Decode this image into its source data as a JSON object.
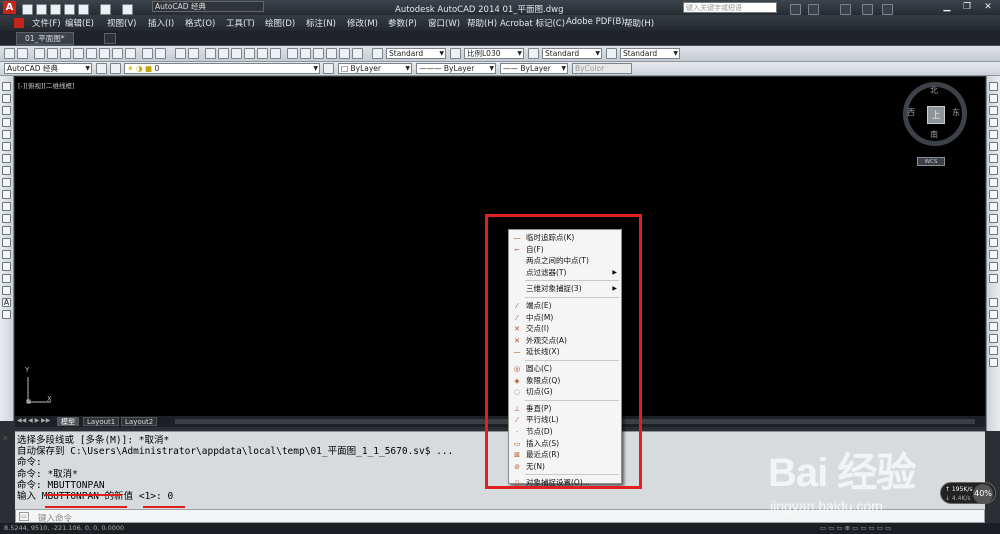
{
  "title_bar": {
    "workspace": "AutoCAD 经典",
    "title": "Autodesk AutoCAD 2014    01_平面图.dwg",
    "search_placeholder": "键入关键字或短语",
    "app_letter": "A"
  },
  "menu": [
    "文件(F)",
    "编辑(E)",
    "视图(V)",
    "插入(I)",
    "格式(O)",
    "工具(T)",
    "绘图(D)",
    "标注(N)",
    "修改(M)",
    "参数(P)",
    "窗口(W)",
    "帮助(H)",
    "Acrobat 标记(C)",
    "Adobe PDF(B)",
    "帮助(H)"
  ],
  "doc_tabs": [
    "01_平面图*"
  ],
  "toolbar": {
    "text_style": "Standard",
    "dim_style": "比例L030",
    "table_style": "Standard",
    "mleader_style": "Standard"
  },
  "toolbar2": {
    "workspace": "AutoCAD 经典",
    "layer": "0",
    "color": "ByLayer",
    "linetype": "ByLayer",
    "lineweight": "ByLayer",
    "plotstyle": "ByColor"
  },
  "viewport_label": "[-][俯视][二维线框]",
  "navcube": {
    "top": "上",
    "north": "北",
    "south": "南",
    "east": "东",
    "west": "西",
    "wcs": "WCS"
  },
  "ucs": {
    "y": "Y",
    "x": "X"
  },
  "layout_tabs": [
    "模型",
    "Layout1",
    "Layout2"
  ],
  "context_menu": {
    "items": [
      {
        "icon": "—",
        "label": "临时追踪点(K)",
        "submenu": false
      },
      {
        "icon": "⌐",
        "label": "自(F)",
        "submenu": false
      },
      {
        "icon": "",
        "label": "两点之间的中点(T)",
        "submenu": false
      },
      {
        "icon": "",
        "label": "点过滤器(T)",
        "submenu": true
      },
      {
        "sep": true
      },
      {
        "icon": "",
        "label": "三维对象捕捉(3)",
        "submenu": true
      },
      {
        "sep": true
      },
      {
        "icon": "⁄",
        "label": "端点(E)",
        "submenu": false
      },
      {
        "icon": "⁄",
        "label": "中点(M)",
        "submenu": false
      },
      {
        "icon": "✕",
        "label": "交点(I)",
        "submenu": false
      },
      {
        "icon": "✕",
        "label": "外观交点(A)",
        "submenu": false
      },
      {
        "icon": "—",
        "label": "延长线(X)",
        "submenu": false
      },
      {
        "sep": true
      },
      {
        "icon": "◎",
        "label": "圆心(C)",
        "submenu": false
      },
      {
        "icon": "◈",
        "label": "象限点(Q)",
        "submenu": false
      },
      {
        "icon": "◌",
        "label": "切点(G)",
        "submenu": false
      },
      {
        "sep": true
      },
      {
        "icon": "⊥",
        "label": "垂直(P)",
        "submenu": false
      },
      {
        "icon": "⁄",
        "label": "平行线(L)",
        "submenu": false
      },
      {
        "icon": "·",
        "label": "节点(D)",
        "submenu": false
      },
      {
        "icon": "▭",
        "label": "插入点(S)",
        "submenu": false
      },
      {
        "icon": "⊠",
        "label": "最近点(R)",
        "submenu": false
      },
      {
        "icon": "⊘",
        "label": "无(N)",
        "submenu": false
      },
      {
        "sep": true
      },
      {
        "icon": "▯",
        "label": "对象捕捉设置(O)...",
        "submenu": false
      }
    ]
  },
  "command_history": [
    "选择多段线或 [多条(M)]: *取消*",
    "自动保存到 C:\\Users\\Administrator\\appdata\\local\\temp\\01_平面图_1_1_5670.sv$ ...",
    "命令:",
    "命令: *取消*",
    "命令: MBUTTONPAN",
    "输入 MBUTTONPAN 的新值 <1>: 0"
  ],
  "command_prompt": "键入命令",
  "status_coords": "8.5244, 9510, -221.106, 0, 0, 0.0000",
  "watermark": {
    "logo": "Bai 经验",
    "url": "jingyan.baidu.com"
  },
  "net_badge": {
    "speed": "↑ 195K/s",
    "speed2": "↓ 4.4K/s",
    "percent": "40%"
  },
  "colors": {
    "accent_red": "#e0201f",
    "canvas": "#000000"
  }
}
